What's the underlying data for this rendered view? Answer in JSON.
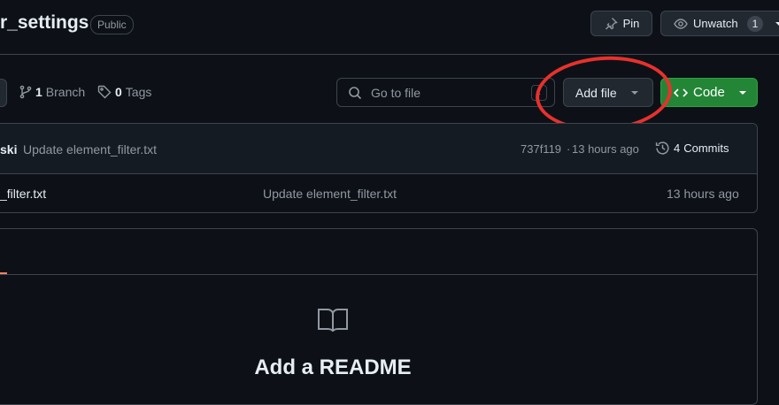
{
  "repo": {
    "name": "r_settings",
    "visibility": "Public"
  },
  "actions": {
    "pin_label": "Pin",
    "pin_icon": "pin-icon",
    "watch_label": "Unwatch",
    "watch_count": "1",
    "watch_icon": "eye-icon"
  },
  "branch_meta": {
    "branch_count": "1",
    "branch_label": "Branch",
    "tag_count": "0",
    "tag_label": "Tags"
  },
  "search": {
    "placeholder": "Go to file",
    "shortcut": "t"
  },
  "toolbar": {
    "add_file_label": "Add file",
    "code_label": "Code"
  },
  "latest_commit": {
    "author": "ski",
    "message": "Update element_filter.txt",
    "hash": "737f119",
    "time": "13 hours ago",
    "separator": "·",
    "commits_count": "4",
    "commits_label": "Commits"
  },
  "files": [
    {
      "name": "_filter.txt",
      "commit_message": "Update element_filter.txt",
      "time": "13 hours ago"
    }
  ],
  "readme": {
    "title": "Add a README"
  },
  "colors": {
    "accent_green": "#238636",
    "annotation_red": "#e8312c",
    "background": "#0d1117"
  }
}
